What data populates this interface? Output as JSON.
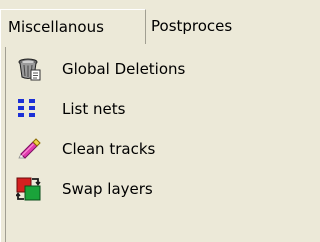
{
  "menubar": {
    "items": [
      {
        "label": "Miscellanous"
      },
      {
        "label": "Postproces"
      }
    ]
  },
  "dropdown": {
    "items": [
      {
        "label": "Global Deletions",
        "icon": "trash-bin-icon"
      },
      {
        "label": "List nets",
        "icon": "list-icon"
      },
      {
        "label": "Clean tracks",
        "icon": "eraser-icon"
      },
      {
        "label": "Swap layers",
        "icon": "swap-layers-icon"
      }
    ]
  },
  "colors": {
    "background": "#ece9d8",
    "list_icon_blue": "#1b2fd6",
    "swap_red": "#d42020",
    "swap_green": "#1aa33a"
  }
}
